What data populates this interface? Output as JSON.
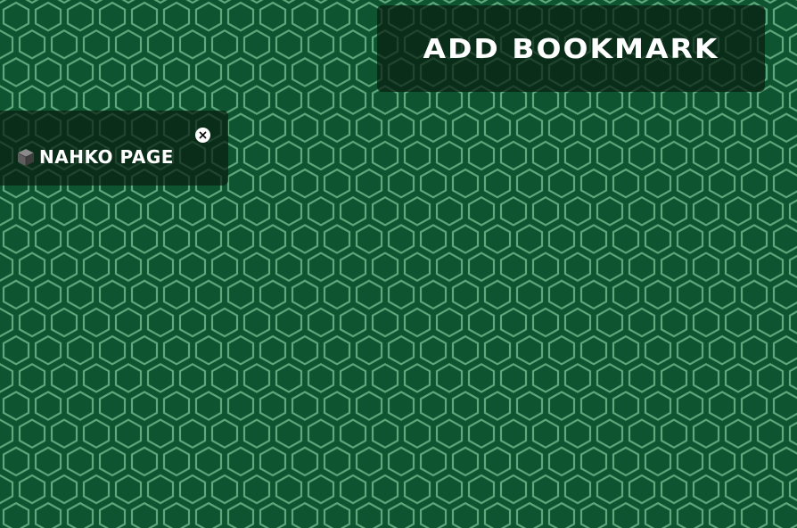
{
  "header": {
    "add_bookmark_label": "ADD BOOKMARK"
  },
  "bookmarks": [
    {
      "label": "NAHKO PAGE",
      "icon": "cube-icon",
      "remove_icon": "close-icon"
    }
  ],
  "colors": {
    "background": "#0e5430",
    "hex_line": "#5fa77c",
    "panel": "#081e11"
  }
}
